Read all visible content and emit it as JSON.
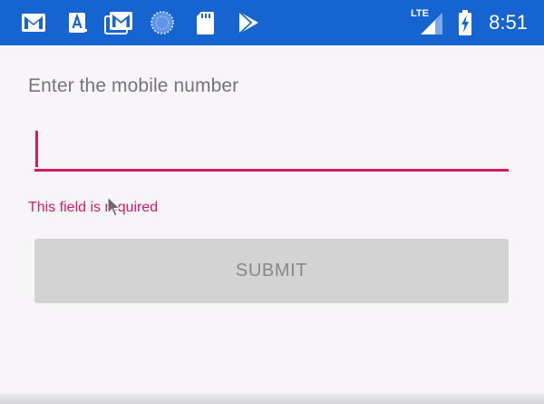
{
  "status_bar": {
    "time": "8:51",
    "network_label": "LTE",
    "icons": [
      "gmail-icon",
      "font-app-icon",
      "gmail-stacked-icon",
      "loading-circle-icon",
      "sd-card-icon",
      "play-store-icon",
      "signal-icon",
      "battery-charging-icon"
    ],
    "background_color": "#1664d0"
  },
  "form": {
    "label": "Enter the mobile number",
    "input_value": "",
    "error_text": "This field is required",
    "submit_label": "SUBMIT",
    "accent_color": "#d81b60",
    "submit_enabled": false
  }
}
